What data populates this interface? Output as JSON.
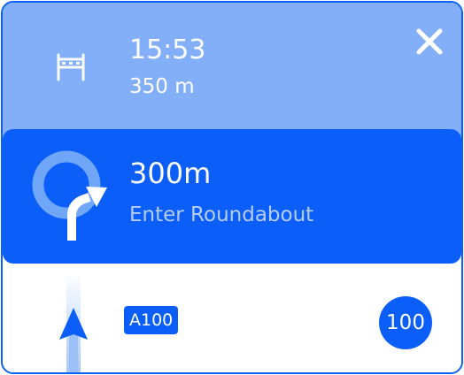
{
  "header": {
    "time": "15:53",
    "distance": "350 m",
    "icons": {
      "barrier": "barrier-icon",
      "close": "close-icon"
    }
  },
  "maneuver": {
    "distance": "300m",
    "instruction": "Enter Roundabout",
    "icon": "roundabout-icon"
  },
  "footer": {
    "road": "A100",
    "speed_limit": "100",
    "icon": "position-arrow-icon"
  },
  "colors": {
    "header_bg": "#82aff8",
    "accent": "#0b5ff8",
    "instruction_text": "#b6cdf9"
  }
}
